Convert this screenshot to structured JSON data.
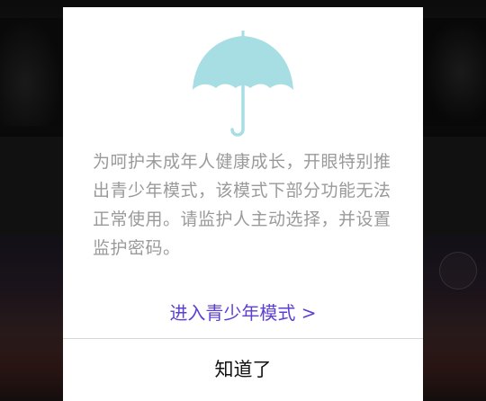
{
  "dialog": {
    "icon": "umbrella-icon",
    "message": "为呵护未成年人健康成长，开眼特别推出青少年模式，该模式下部分功能无法正常使用。请监护人主动选择，并设置监护密码。",
    "enter_link_label": "进入青少年模式 >",
    "ok_label": "知道了"
  },
  "colors": {
    "umbrella": "#a6dee3",
    "link": "#5d3fd3",
    "message_text": "#9a9a9a",
    "ok_text": "#111111",
    "divider": "#d6d6d6",
    "modal_background": "#ffffff"
  }
}
